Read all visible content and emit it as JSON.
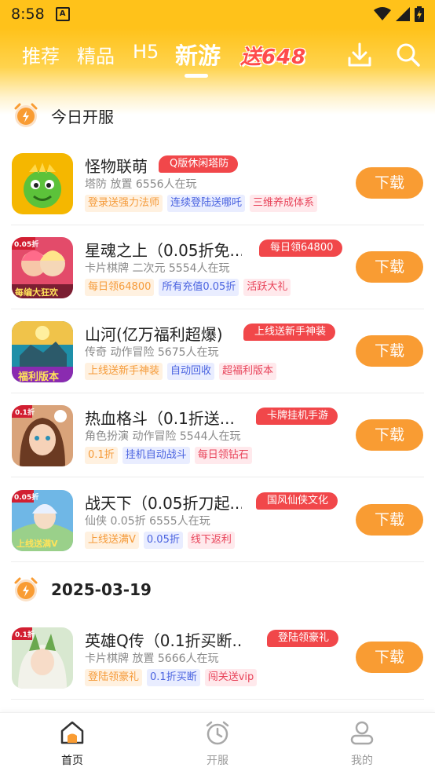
{
  "status_bar": {
    "time": "8:58",
    "indicator": "A"
  },
  "header": {
    "tabs": [
      {
        "label": "推荐"
      },
      {
        "label": "精品"
      },
      {
        "label": "H5"
      },
      {
        "label": "新游"
      }
    ],
    "promo_text": "送648",
    "icons": [
      "download-icon",
      "search-icon"
    ]
  },
  "sections": [
    {
      "title": "今日开服"
    },
    {
      "title": "2025-03-19"
    }
  ],
  "games": [
    {
      "title": "怪物联萌",
      "badge": "Q版休闲塔防",
      "sub": "塔防 放置  6556人在玩",
      "tags": [
        {
          "text": "登录送强力法师",
          "color": "orange"
        },
        {
          "text": "连续登陆送哪吒",
          "color": "blue"
        },
        {
          "text": "三维养成体系",
          "color": "red"
        }
      ],
      "button": "下载"
    },
    {
      "title": "星魂之上（0.05折免...",
      "badge": "每日领64800",
      "sub": "卡片棋牌 二次元  5554人在玩",
      "tags": [
        {
          "text": "每日领64800",
          "color": "orange"
        },
        {
          "text": "所有充值0.05折",
          "color": "blue"
        },
        {
          "text": "活跃大礼",
          "color": "red"
        }
      ],
      "button": "下载",
      "icon_text": "0.05折",
      "icon_caption": "每编大狂欢"
    },
    {
      "title": "山河(亿万福利超爆)",
      "badge": "上线送新手神装",
      "sub": "传奇 动作冒险  5675人在玩",
      "tags": [
        {
          "text": "上线送新手神装",
          "color": "orange"
        },
        {
          "text": "自动回收",
          "color": "blue"
        },
        {
          "text": "超福利版本",
          "color": "red"
        }
      ],
      "button": "下载",
      "icon_caption": "福利版本"
    },
    {
      "title": "热血格斗（0.1折送...",
      "badge": "卡牌挂机手游",
      "sub": "角色扮演 动作冒险  5544人在玩",
      "tags": [
        {
          "text": "0.1折",
          "color": "orange"
        },
        {
          "text": "挂机自动战斗",
          "color": "blue"
        },
        {
          "text": "每日领钻石",
          "color": "red"
        }
      ],
      "button": "下载",
      "icon_text": "0.1折"
    },
    {
      "title": "战天下（0.05折刀起...",
      "badge": "国风仙侠文化",
      "sub": "仙侠 0.05折  6555人在玩",
      "tags": [
        {
          "text": "上线送满V",
          "color": "orange"
        },
        {
          "text": "0.05折",
          "color": "blue"
        },
        {
          "text": "线下返利",
          "color": "red"
        }
      ],
      "button": "下载",
      "icon_text": "0.05折",
      "icon_caption": "上线送满V"
    },
    {
      "title": "英雄Q传（0.1折买断...",
      "badge": "登陆领豪礼",
      "sub": "卡片棋牌 放置  5666人在玩",
      "tags": [
        {
          "text": "登陆领豪礼",
          "color": "orange"
        },
        {
          "text": "0.1折买断",
          "color": "blue"
        },
        {
          "text": "闯关送vip",
          "color": "red"
        }
      ],
      "button": "下载",
      "icon_text": "0.1折"
    }
  ],
  "bottom_nav": [
    {
      "label": "首页",
      "active": true,
      "icon": "home-icon"
    },
    {
      "label": "开服",
      "active": false,
      "icon": "alarm-clock-icon"
    },
    {
      "label": "我的",
      "active": false,
      "icon": "profile-icon"
    }
  ],
  "colors": {
    "brand": "#ffc21a",
    "button": "#f99c33",
    "badge": "#f1474a"
  }
}
